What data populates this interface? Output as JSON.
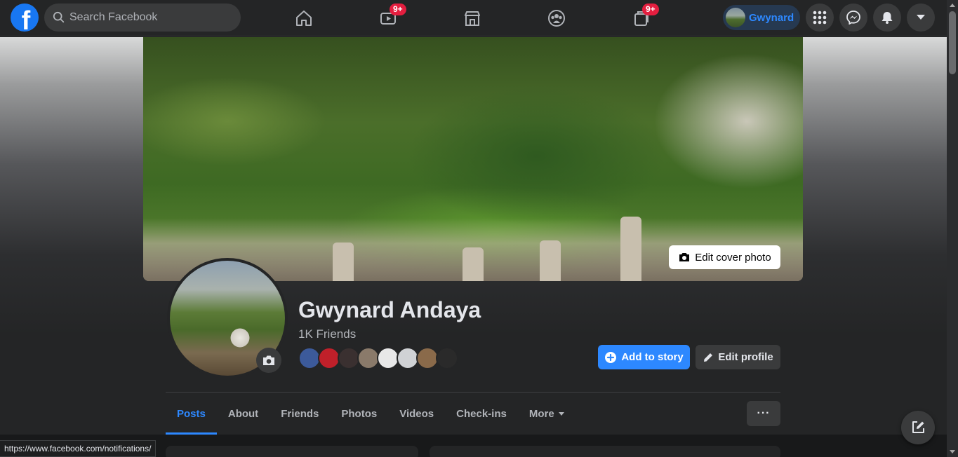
{
  "topbar": {
    "logo_letter": "f",
    "search_placeholder": "Search Facebook",
    "nav": [
      {
        "name": "home",
        "icon": "home-icon"
      },
      {
        "name": "watch",
        "icon": "video-icon",
        "badge": "9+"
      },
      {
        "name": "marketplace",
        "icon": "store-icon"
      },
      {
        "name": "groups",
        "icon": "groups-icon"
      },
      {
        "name": "gaming",
        "icon": "gaming-icon",
        "badge": "9+"
      }
    ],
    "user_chip": "Gwynard",
    "menu_icon": "grid-menu-icon",
    "messenger_icon": "messenger-icon",
    "notifications_icon": "bell-icon",
    "account_icon": "caret-down-icon"
  },
  "cover": {
    "edit_cover_label": "Edit cover photo"
  },
  "profile": {
    "name": "Gwynard Andaya",
    "friends_count": "1K Friends",
    "friend_avatar_colors": [
      "#3c5a9a",
      "#c0202a",
      "#3a3030",
      "#8a7a6a",
      "#e8e8e8",
      "#d0d2d5",
      "#8a6a4a",
      "#2a2a2a"
    ],
    "add_story_label": "Add to story",
    "edit_profile_label": "Edit profile"
  },
  "tabs": [
    {
      "label": "Posts",
      "active": true
    },
    {
      "label": "About",
      "active": false
    },
    {
      "label": "Friends",
      "active": false
    },
    {
      "label": "Photos",
      "active": false
    },
    {
      "label": "Videos",
      "active": false
    },
    {
      "label": "Check-ins",
      "active": false
    },
    {
      "label": "More",
      "active": false
    }
  ],
  "more_options": "···",
  "status_url": "https://www.facebook.com/notifications/",
  "colors": {
    "accent": "#2d88ff",
    "badge": "#e41e3f",
    "background": "#18191a",
    "surface": "#242526"
  }
}
